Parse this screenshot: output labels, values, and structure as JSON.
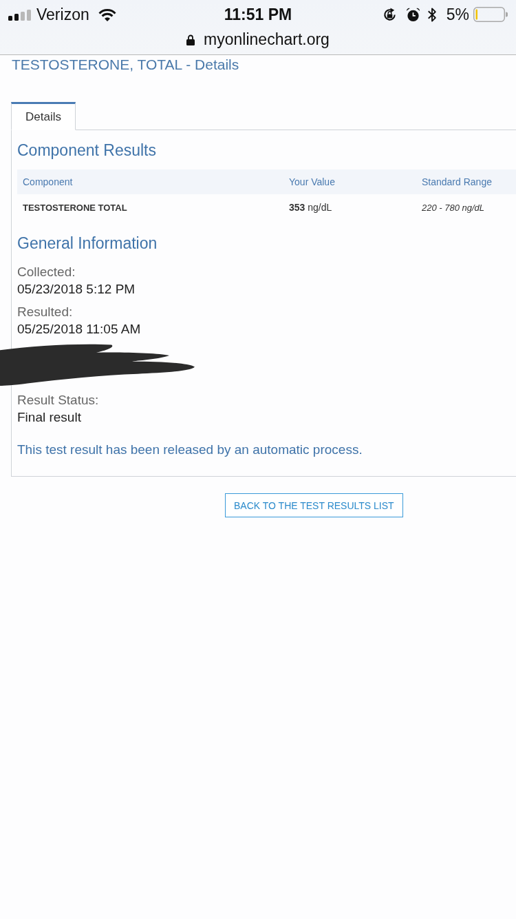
{
  "status_bar": {
    "carrier": "Verizon",
    "time": "11:51 PM",
    "battery_percent": "5%"
  },
  "address_bar": {
    "url": "myonlinechart.org"
  },
  "page_title": "TESTOSTERONE, TOTAL - Details",
  "tabs": [
    {
      "label": "Details",
      "selected": true
    }
  ],
  "component_results": {
    "title": "Component Results",
    "columns": [
      "Component",
      "Your Value",
      "Standard Range"
    ],
    "rows": [
      {
        "component": "TESTOSTERONE TOTAL",
        "value": "**353** ng/dL",
        "range": "220 - 780 ng/dL"
      }
    ]
  },
  "general_information": {
    "title": "General Information",
    "fields": [
      {
        "kind": "field",
        "label": "Collected:",
        "value": "05/23/2018 5:12 PM"
      },
      {
        "kind": "field",
        "label": "Resulted:",
        "value": "05/25/2018 11:05 AM"
      },
      {
        "kind": "redacted"
      },
      {
        "kind": "field",
        "label": "Result Status:",
        "value": "Final result"
      }
    ],
    "note": "This test result has been released by an automatic process."
  },
  "back_button": "BACK TO THE TEST RESULTS LIST"
}
